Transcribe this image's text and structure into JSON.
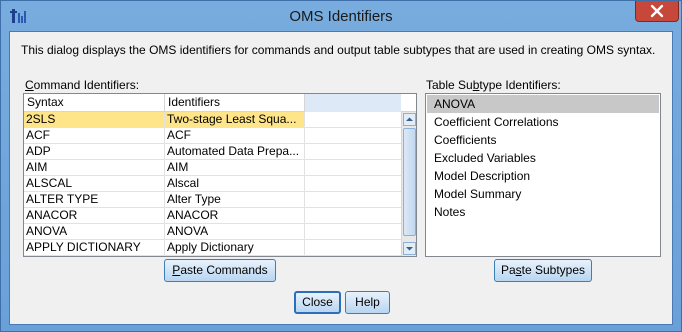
{
  "window": {
    "title": "OMS Identifiers"
  },
  "description": "This dialog displays the OMS identifiers for commands and output table subtypes that are used in creating OMS syntax.",
  "command_identifiers": {
    "label_accel": "C",
    "label_rest": "ommand Identifiers:",
    "columns": [
      "Syntax",
      "Identifiers"
    ],
    "rows": [
      {
        "syntax": "2SLS",
        "identifier": "Two-stage Least Squa...",
        "selected": true
      },
      {
        "syntax": "ACF",
        "identifier": "ACF"
      },
      {
        "syntax": "ADP",
        "identifier": "Automated Data Prepa..."
      },
      {
        "syntax": "AIM",
        "identifier": "AIM"
      },
      {
        "syntax": "ALSCAL",
        "identifier": "Alscal"
      },
      {
        "syntax": "ALTER TYPE",
        "identifier": "Alter Type"
      },
      {
        "syntax": "ANACOR",
        "identifier": "ANACOR"
      },
      {
        "syntax": "ANOVA",
        "identifier": "ANOVA"
      },
      {
        "syntax": "APPLY DICTIONARY",
        "identifier": "Apply Dictionary"
      }
    ]
  },
  "table_subtypes": {
    "label_pre": "Table Su",
    "label_accel": "b",
    "label_rest": "type Identifiers:",
    "items": [
      "ANOVA",
      "Coefficient Correlations",
      "Coefficients",
      "Excluded Variables",
      "Model Description",
      "Model Summary",
      "Notes"
    ],
    "selected_index": 0
  },
  "buttons": {
    "paste_commands_accel": "P",
    "paste_commands_rest": "aste Commands",
    "paste_subtypes_pre": "Pa",
    "paste_subtypes_accel": "s",
    "paste_subtypes_rest": "te Subtypes",
    "close": "Close",
    "help": "Help"
  },
  "icons": {
    "app": "spss-app-icon",
    "close": "close-icon",
    "scroll_up": "arrow-up-icon",
    "scroll_down": "arrow-down-icon"
  },
  "colors": {
    "title_bar": "#6aa0d8",
    "selected_row": "#fee58a",
    "selected_list_item": "#c8c8c8",
    "close_button": "#c7473a"
  }
}
